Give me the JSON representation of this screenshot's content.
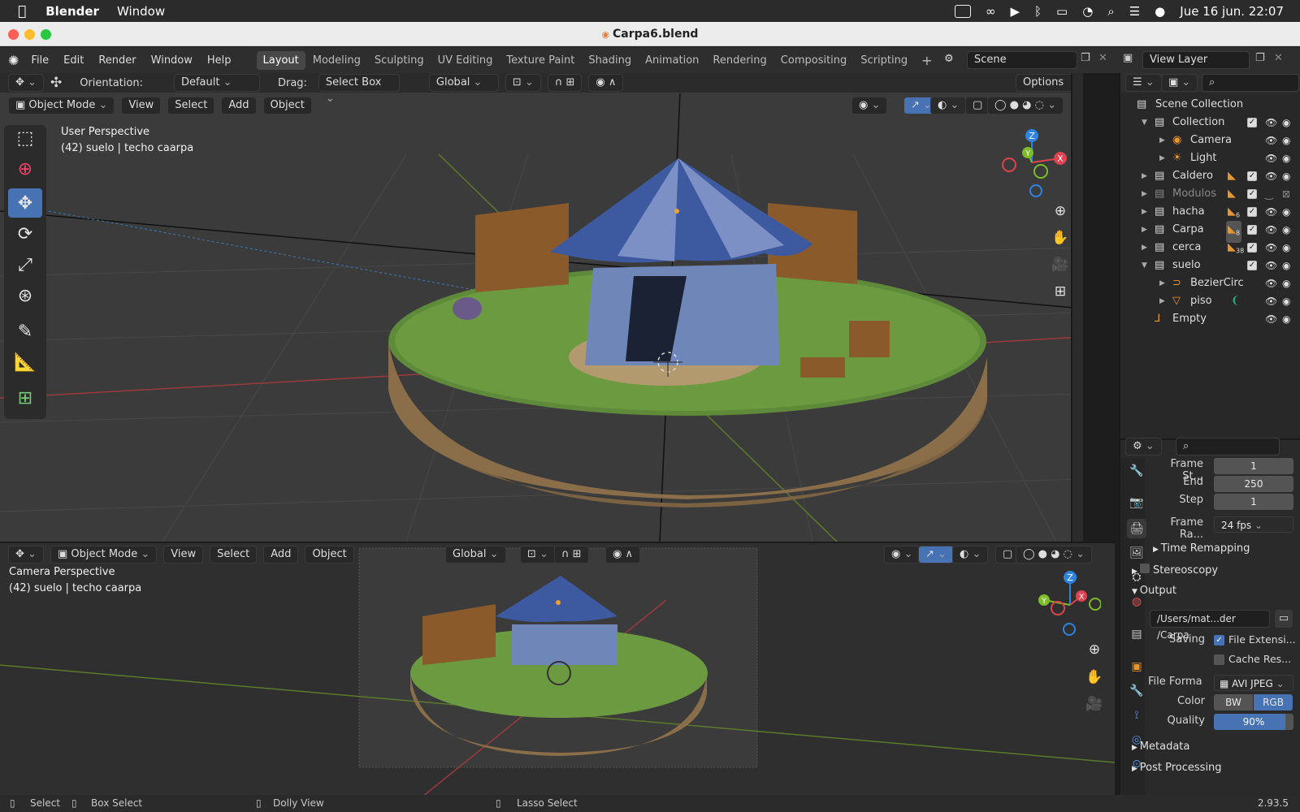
{
  "mac": {
    "apple_icon": "",
    "app": "Blender",
    "menu": "Window",
    "datetime": "Jue 16 jun.  22:07"
  },
  "window": {
    "title": "Carpa6.blend"
  },
  "topbar": {
    "menus": [
      "File",
      "Edit",
      "Render",
      "Window",
      "Help"
    ],
    "workspaces": [
      "Layout",
      "Modeling",
      "Sculpting",
      "UV Editing",
      "Texture Paint",
      "Shading",
      "Animation",
      "Rendering",
      "Compositing",
      "Scripting"
    ],
    "add_workspace": "+",
    "scene": "Scene",
    "view_layer": "View Layer"
  },
  "tool_header": {
    "orientation_label": "Orientation:",
    "orientation_value": "Default",
    "drag_label": "Drag:",
    "drag_value": "Select Box",
    "transform": "Global",
    "options": "Options"
  },
  "vp1": {
    "mode": "Object Mode",
    "menus": [
      "View",
      "Select",
      "Add",
      "Object"
    ],
    "info1": "User Perspective",
    "info2": "(42) suelo | techo caarpa"
  },
  "vp2": {
    "mode": "Object Mode",
    "menus": [
      "View",
      "Select",
      "Add",
      "Object"
    ],
    "transform": "Global",
    "info1": "Camera Perspective",
    "info2": "(42) suelo | techo caarpa"
  },
  "axes": {
    "z": "Z",
    "y": "Y",
    "x": "X"
  },
  "outliner": {
    "title": "Scene Collection",
    "rows": [
      {
        "label": "Collection"
      },
      {
        "label": "Camera"
      },
      {
        "label": "Light"
      },
      {
        "label": "Caldero"
      },
      {
        "label": "Modulos"
      },
      {
        "label": "hacha",
        "badge": "6"
      },
      {
        "label": "Carpa",
        "badge": "8"
      },
      {
        "label": "cerca",
        "badge": "38"
      },
      {
        "label": "suelo"
      },
      {
        "label": "BezierCirc"
      },
      {
        "label": "piso"
      },
      {
        "label": "Empty"
      }
    ]
  },
  "props": {
    "frame_start_label": "Frame St...",
    "frame_start": "1",
    "end_label": "End",
    "end": "250",
    "step_label": "Step",
    "step": "1",
    "frame_rate_label": "Frame Ra...",
    "frame_rate": "24 fps",
    "time_remapping": "Time Remapping",
    "stereoscopy": "Stereoscopy",
    "output": "Output",
    "output_path": "/Users/mat...der /Carpa",
    "saving_label": "Saving",
    "file_ext": "File Extensi...",
    "cache_res": "Cache Res...",
    "file_format_label": "File Forma",
    "file_format": "AVI JPEG",
    "color_label": "Color",
    "bw": "BW",
    "rgb": "RGB",
    "quality_label": "Quality",
    "quality": "90%",
    "quality_value": 0.9,
    "metadata": "Metadata",
    "post_processing": "Post Processing"
  },
  "status": {
    "select": "Select",
    "box_select": "Box Select",
    "dolly": "Dolly View",
    "lasso": "Lasso Select",
    "version": "2.93.5"
  },
  "colors": {
    "accent": "#4772b3",
    "x_axis": "#e0424f",
    "y_axis": "#7fbb2a",
    "z_axis": "#2f83e0"
  }
}
